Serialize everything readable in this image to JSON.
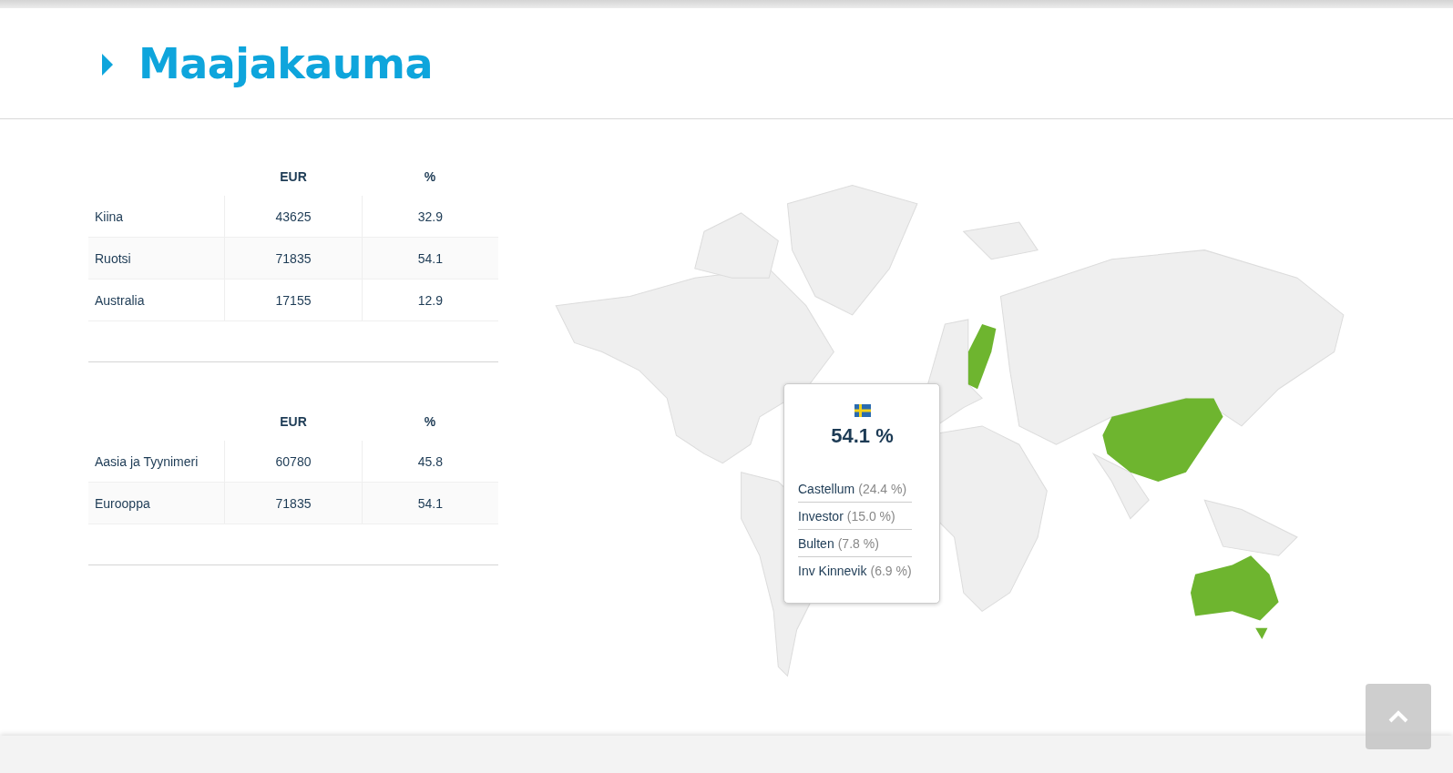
{
  "section": {
    "title": "Maajakauma"
  },
  "tables": [
    {
      "columns": [
        "EUR",
        "%"
      ],
      "rows": [
        {
          "name": "Kiina",
          "eur": "43625",
          "pct": "32.9"
        },
        {
          "name": "Ruotsi",
          "eur": "71835",
          "pct": "54.1"
        },
        {
          "name": "Australia",
          "eur": "17155",
          "pct": "12.9"
        }
      ]
    },
    {
      "columns": [
        "EUR",
        "%"
      ],
      "rows": [
        {
          "name": "Aasia ja Tyynimeri",
          "eur": "60780",
          "pct": "45.8"
        },
        {
          "name": "Eurooppa",
          "eur": "71835",
          "pct": "54.1"
        }
      ]
    }
  ],
  "tooltip": {
    "value": "54.1 %",
    "holdings": [
      {
        "name": "Castellum",
        "pct": "(24.4 %)"
      },
      {
        "name": "Investor",
        "pct": "(15.0 %)"
      },
      {
        "name": "Bulten",
        "pct": "(7.8 %)"
      },
      {
        "name": "Inv Kinnevik",
        "pct": "(6.9 %)"
      }
    ]
  }
}
